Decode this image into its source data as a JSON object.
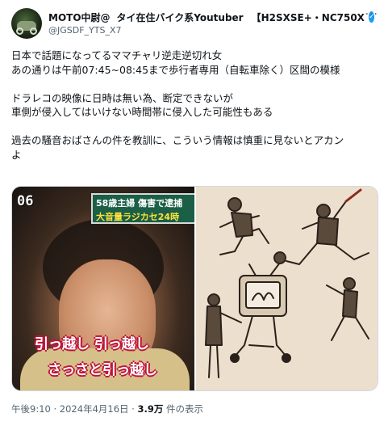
{
  "author": {
    "name": "MOTO中尉@",
    "name_mid": "タイ在住バイク系Youtuber",
    "name_tail": "【H2SXSE+・NC750X",
    "handle": "@JGSDF_YTS_X7",
    "verified": true,
    "more_label": "···"
  },
  "tweet": {
    "lines": [
      "日本で話題になってるママチャリ逆走逆切れ女",
      "あの通りは午前07:45~08:45まで歩行者専用（自転車除く）区間の模様",
      "",
      "ドラレコの映像に日時は無い為、断定できないが",
      "車側が侵入してはいけない時間帯に侵入した可能性もある",
      "",
      "過去の騒音おばさんの件を教訓に、こういう情報は慎重に見ないとアカン",
      "よ"
    ]
  },
  "media": {
    "left": {
      "tv_number": "06",
      "caption_top": "58歳主婦 傷害で逮捕",
      "caption_bottom": "大音量ラジカセ24時",
      "subtitle_1": "引っ越し 引っ越し",
      "subtitle_2": "さっさと引っ越し"
    },
    "right": {
      "scene": "illustration"
    }
  },
  "meta": {
    "time": "午後9:10",
    "separator": "·",
    "date": "2024年4月16日",
    "views_count": "3.9万",
    "views_label": "件の表示"
  }
}
